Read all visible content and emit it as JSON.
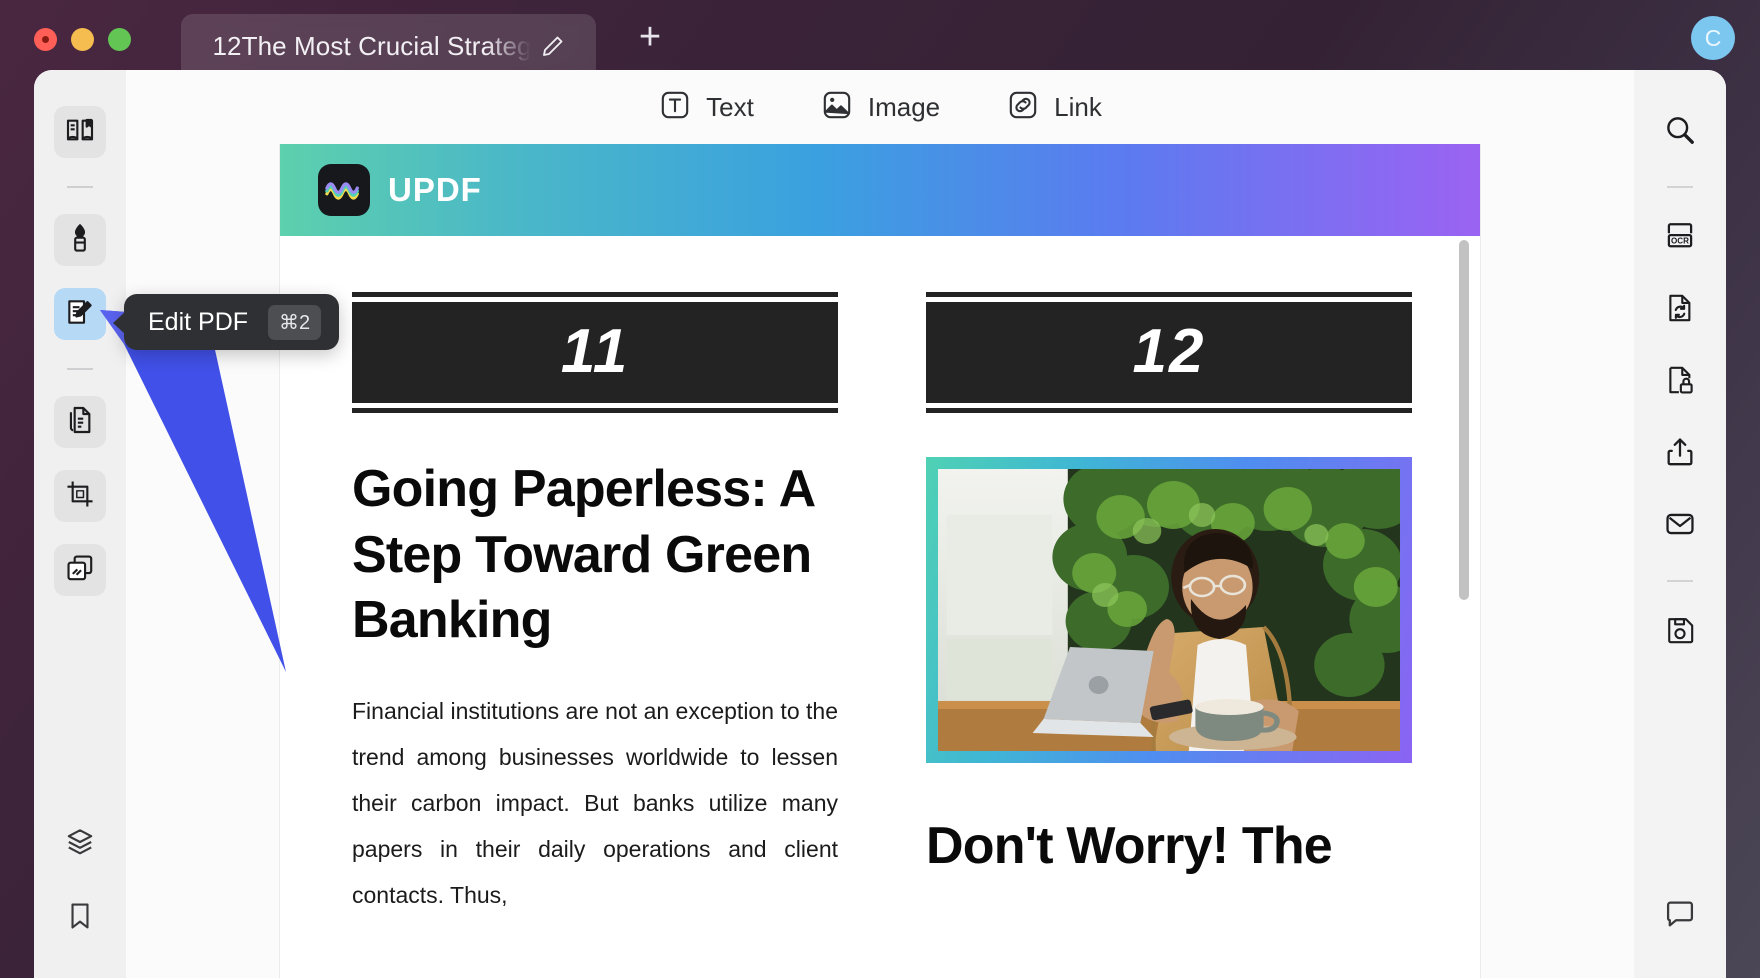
{
  "window": {
    "traffic_lights": [
      "close",
      "minimize",
      "maximize"
    ],
    "avatar_initial": "C",
    "new_tab_label": "+"
  },
  "tab": {
    "title": "12The Most Crucial Strateg",
    "edit_icon": "pencil-icon"
  },
  "left_rail": {
    "items": [
      {
        "name": "reader-mode",
        "icon": "book-reader-icon",
        "state": "normal"
      },
      {
        "name": "divider-1",
        "icon": "divider",
        "state": "divider"
      },
      {
        "name": "annotate",
        "icon": "highlighter-pen-icon",
        "state": "normal"
      },
      {
        "name": "edit-pdf",
        "icon": "edit-document-pencil-icon",
        "state": "active"
      },
      {
        "name": "divider-2",
        "icon": "divider",
        "state": "divider"
      },
      {
        "name": "organize-pages",
        "icon": "page-copy-icon",
        "state": "normal"
      },
      {
        "name": "crop-page",
        "icon": "crop-icon",
        "state": "normal"
      },
      {
        "name": "batch-process",
        "icon": "stacked-pages-icon",
        "state": "normal"
      }
    ],
    "bottom_items": [
      {
        "name": "layers",
        "icon": "layers-icon"
      },
      {
        "name": "bookmark",
        "icon": "bookmark-icon"
      }
    ]
  },
  "tooltip": {
    "label": "Edit PDF",
    "shortcut": "⌘2"
  },
  "edit_toolbar": {
    "items": [
      {
        "label": "Text",
        "icon": "text-box-icon"
      },
      {
        "label": "Image",
        "icon": "image-icon"
      },
      {
        "label": "Link",
        "icon": "link-chain-icon"
      }
    ]
  },
  "right_rail": {
    "items": [
      {
        "name": "search",
        "icon": "search-magnifier-icon"
      },
      {
        "name": "divider-1",
        "icon": "divider"
      },
      {
        "name": "ocr",
        "icon": "ocr-icon"
      },
      {
        "name": "convert-pdf",
        "icon": "document-refresh-icon"
      },
      {
        "name": "protect",
        "icon": "document-lock-icon"
      },
      {
        "name": "share",
        "icon": "share-upload-icon"
      },
      {
        "name": "email",
        "icon": "envelope-icon"
      },
      {
        "name": "divider-2",
        "icon": "divider"
      },
      {
        "name": "save",
        "icon": "floppy-save-icon"
      }
    ],
    "bottom_items": [
      {
        "name": "comments",
        "icon": "comment-bubble-icon"
      }
    ]
  },
  "document": {
    "banner": {
      "brand": "UPDF",
      "logo_icon": "updf-app-icon",
      "gradient": [
        "#5dd0ad",
        "#3ba0e0",
        "#9b63f2"
      ]
    },
    "left_column": {
      "number": "11",
      "heading": "Going Paperless: A Step Toward Green Banking",
      "body": "Financial institutions are not an exception to the trend among businesses worldwide to lessen their carbon impact. But banks utilize many papers in their daily operations and client contacts. Thus,"
    },
    "right_column": {
      "number": "12",
      "photo_alt": "Bearded man with glasses giving a thumbs up while sitting at a wooden table with a laptop, phone and coffee cup in front of a green plant wall",
      "heading": "Don't Worry! The"
    }
  },
  "scrollbar": {
    "name": "page-vertical-scrollbar"
  },
  "colors": {
    "window_chrome": "#3b2339",
    "rail_background": "#f0f0f1",
    "active_tool": "#b6d9f5",
    "tooltip_background": "#2f3033",
    "annotation_arrow": "#4150e8",
    "avatar": "#7cc7f0"
  }
}
